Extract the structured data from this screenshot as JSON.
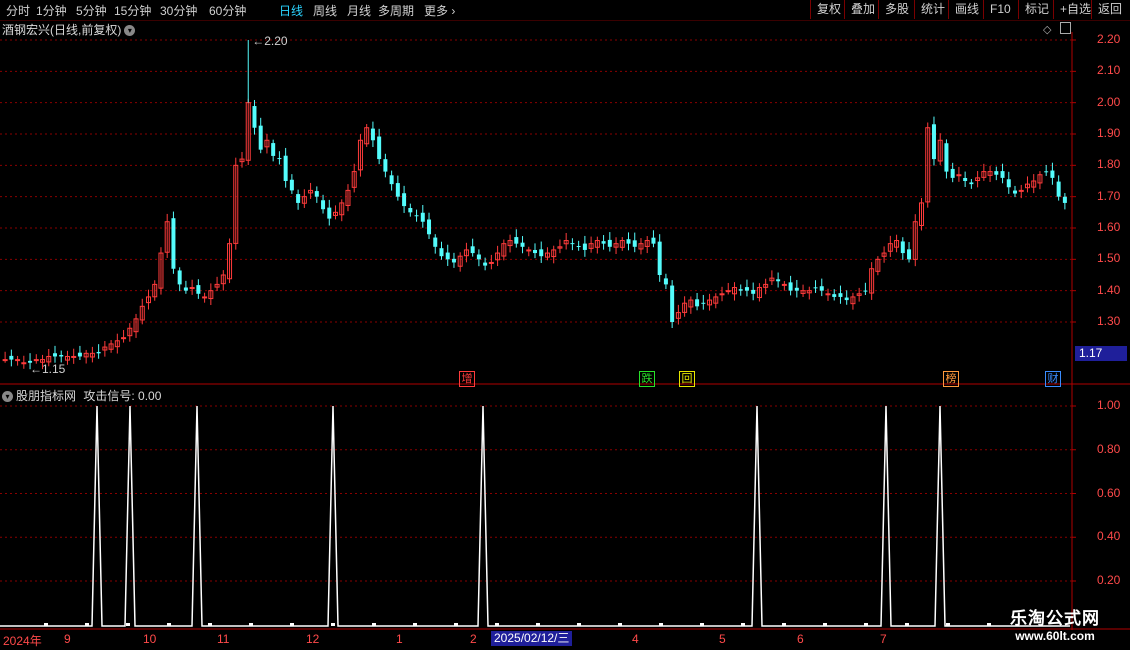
{
  "toolbar": {
    "periods": [
      "分时",
      "1分钟",
      "5分钟",
      "15分钟",
      "30分钟",
      "60分钟",
      "日线",
      "周线",
      "月线",
      "多周期",
      "更多"
    ],
    "active_period": "日线",
    "right_buttons": [
      "复权",
      "叠加",
      "多股",
      "统计",
      "画线",
      "F10",
      "标记",
      "+自选",
      "返回"
    ]
  },
  "main_chart": {
    "title": "酒钢宏兴(日线,前复权)",
    "y_ticks": [
      "2.20",
      "2.10",
      "2.00",
      "1.90",
      "1.80",
      "1.70",
      "1.60",
      "1.50",
      "1.40",
      "1.30"
    ],
    "high_label": "2.20",
    "low_label": "1.15",
    "current_price": "1.17",
    "events": [
      {
        "text": "增",
        "color": "#ff3b3b"
      },
      {
        "text": "跌",
        "color": "#29e029"
      },
      {
        "text": "回",
        "color": "#e6e600"
      },
      {
        "text": "榜",
        "color": "#ff9a3c"
      },
      {
        "text": "财",
        "color": "#3a8cff"
      }
    ]
  },
  "indicator": {
    "title": "股朋指标网",
    "signal_label": "攻击信号:",
    "signal_value": "0.00",
    "y_ticks": [
      "1.00",
      "0.80",
      "0.60",
      "0.40",
      "0.20"
    ]
  },
  "x_axis": {
    "labels": [
      "2024年",
      "9",
      "10",
      "11",
      "12",
      "1",
      "2",
      "4",
      "5",
      "6",
      "7"
    ],
    "highlight_date": "2025/02/12/三"
  },
  "watermark": {
    "line1": "乐淘公式网",
    "line2": "www.60lt.com"
  },
  "colors": {
    "up": "#ff3b3b",
    "down": "#54fcfc",
    "axis": "#b00000",
    "grid": "#8a0000",
    "signal": "#ffffff"
  },
  "chart_data": [
    {
      "type": "candlestick",
      "title": "酒钢宏兴(日线,前复权)",
      "ylim": [
        1.15,
        2.22
      ],
      "y_ticks": [
        2.2,
        2.1,
        2.0,
        1.9,
        1.8,
        1.7,
        1.6,
        1.5,
        1.4,
        1.3
      ],
      "max": 2.2,
      "min": 1.15,
      "last": 1.17,
      "close_series": [
        1.18,
        1.18,
        1.18,
        1.17,
        1.17,
        1.18,
        1.18,
        1.19,
        1.19,
        1.19,
        1.19,
        1.19,
        1.19,
        1.2,
        1.2,
        1.2,
        1.22,
        1.23,
        1.24,
        1.25,
        1.28,
        1.31,
        1.35,
        1.38,
        1.42,
        1.52,
        1.62,
        1.47,
        1.42,
        1.4,
        1.41,
        1.39,
        1.38,
        1.4,
        1.42,
        1.45,
        1.55,
        1.8,
        1.82,
        2.0,
        1.92,
        1.85,
        1.88,
        1.83,
        1.82,
        1.75,
        1.72,
        1.68,
        1.7,
        1.72,
        1.7,
        1.66,
        1.63,
        1.65,
        1.68,
        1.72,
        1.78,
        1.88,
        1.92,
        1.88,
        1.82,
        1.78,
        1.74,
        1.7,
        1.67,
        1.65,
        1.64,
        1.62,
        1.58,
        1.54,
        1.51,
        1.5,
        1.49,
        1.51,
        1.53,
        1.52,
        1.5,
        1.48,
        1.49,
        1.52,
        1.55,
        1.56,
        1.55,
        1.54,
        1.53,
        1.52,
        1.51,
        1.52,
        1.53,
        1.54,
        1.56,
        1.55,
        1.54,
        1.53,
        1.55,
        1.56,
        1.55,
        1.54,
        1.55,
        1.56,
        1.55,
        1.54,
        1.55,
        1.56,
        1.55,
        1.45,
        1.42,
        1.3,
        1.33,
        1.36,
        1.37,
        1.35,
        1.36,
        1.37,
        1.38,
        1.39,
        1.4,
        1.41,
        1.4,
        1.4,
        1.39,
        1.41,
        1.42,
        1.44,
        1.43,
        1.42,
        1.4,
        1.4,
        1.4,
        1.4,
        1.41,
        1.4,
        1.39,
        1.38,
        1.38,
        1.37,
        1.38,
        1.39,
        1.4,
        1.47,
        1.5,
        1.52,
        1.55,
        1.56,
        1.52,
        1.5,
        1.62,
        1.68,
        1.92,
        1.82,
        1.88,
        1.78,
        1.76,
        1.77,
        1.75,
        1.74,
        1.76,
        1.78,
        1.78,
        1.77,
        1.76,
        1.73,
        1.71,
        1.72,
        1.74,
        1.75,
        1.77,
        1.78,
        1.76,
        1.7,
        1.68
      ]
    },
    {
      "type": "line",
      "title": "股朋指标网",
      "series": [
        {
          "name": "攻击信号",
          "values": [
            1,
            1,
            1,
            1,
            1,
            1,
            1,
            1,
            1
          ],
          "signal_x": [
            97,
            130,
            197,
            333,
            483,
            757,
            886,
            940
          ]
        }
      ],
      "ylim": [
        0,
        1.0
      ],
      "y_ticks": [
        1.0,
        0.8,
        0.6,
        0.4,
        0.2
      ]
    }
  ]
}
